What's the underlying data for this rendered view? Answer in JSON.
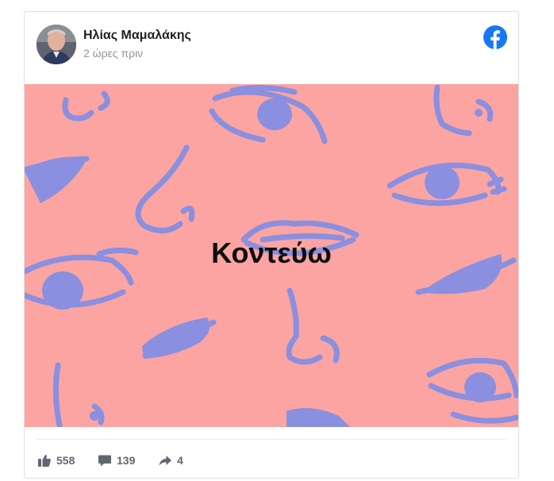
{
  "post": {
    "author_name": "Ηλίας Μαμαλάκης",
    "timestamp": "2 ώρες πριν",
    "image_text": "Κοντεύω",
    "platform_icon": "facebook-icon"
  },
  "stats": {
    "likes": "558",
    "comments": "139",
    "shares": "4"
  },
  "colors": {
    "image_background": "#fba4a2",
    "pattern": "#8a8fe0",
    "facebook_blue": "#1877f2",
    "stat_text": "#606770"
  }
}
